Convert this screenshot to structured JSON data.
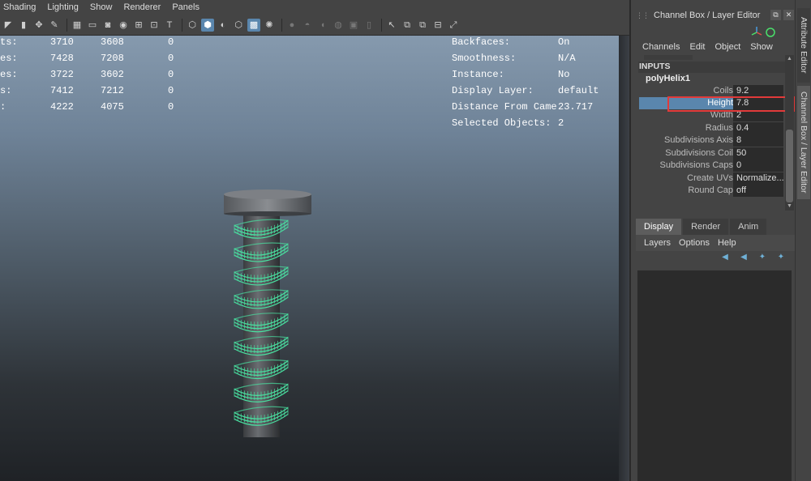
{
  "viewport": {
    "menu": [
      "Shading",
      "Lighting",
      "Show",
      "Renderer",
      "Panels"
    ],
    "toolbar_icons": [
      "bookmark-icon",
      "image-plane-icon",
      "camera-move-icon",
      "pencil-icon",
      "grid-icon",
      "film-gate-icon",
      "resolution-gate-icon",
      "safe-action-icon",
      "field-chart-icon",
      "safe-title-icon",
      "wireframe-icon",
      "smooth-shade-icon",
      "shaded-wireframe-icon",
      "xray-icon",
      "textured-icon",
      "light-icon",
      "shadow-icon",
      "ssao-icon",
      "motion-blur-icon",
      "antialias-icon",
      "dof-icon",
      "isolate-select-icon",
      "xray-joints-icon",
      "xray-active-icon",
      "backface-icon"
    ],
    "hud_left": [
      {
        "label": "ts:",
        "a": "3710",
        "b": "3608",
        "c": "0"
      },
      {
        "label": "es:",
        "a": "7428",
        "b": "7208",
        "c": "0"
      },
      {
        "label": "es:",
        "a": "3722",
        "b": "3602",
        "c": "0"
      },
      {
        "label": "s:",
        "a": "7412",
        "b": "7212",
        "c": "0"
      },
      {
        "label": ":",
        "a": "4222",
        "b": "4075",
        "c": "0"
      }
    ],
    "hud_right": [
      {
        "label": "Backfaces:",
        "value": "On"
      },
      {
        "label": "Smoothness:",
        "value": "N/A"
      },
      {
        "label": "Instance:",
        "value": "No"
      },
      {
        "label": "Display Layer:",
        "value": "default"
      },
      {
        "label": "Distance From Camera:",
        "value": "23.717"
      },
      {
        "label": "Selected Objects:",
        "value": "2"
      }
    ]
  },
  "channel_box": {
    "title": "Channel Box / Layer Editor",
    "menu": [
      "Channels",
      "Edit",
      "Object",
      "Show"
    ],
    "inputs_header": "INPUTS",
    "node_name": "polyHelix1",
    "attributes": [
      {
        "label": "Coils",
        "value": "9.2"
      },
      {
        "label": "Height",
        "value": "7.8"
      },
      {
        "label": "Width",
        "value": "2"
      },
      {
        "label": "Radius",
        "value": "0.4"
      },
      {
        "label": "Subdivisions Axis",
        "value": "8"
      },
      {
        "label": "Subdivisions Coil",
        "value": "50"
      },
      {
        "label": "Subdivisions Caps",
        "value": "0"
      },
      {
        "label": "Create UVs",
        "value": "Normalize..."
      },
      {
        "label": "Round Cap",
        "value": "off"
      }
    ],
    "selected_attribute": "Height"
  },
  "layer_editor": {
    "tabs": [
      "Display",
      "Render",
      "Anim"
    ],
    "active_tab": "Display",
    "menu": [
      "Layers",
      "Options",
      "Help"
    ]
  },
  "side_tabs": [
    "Attribute Editor",
    "Channel Box / Layer Editor"
  ],
  "colors": {
    "selection": "#5a86ad",
    "highlight_box": "#e23a3a",
    "wireframe": "#49e0a0"
  }
}
